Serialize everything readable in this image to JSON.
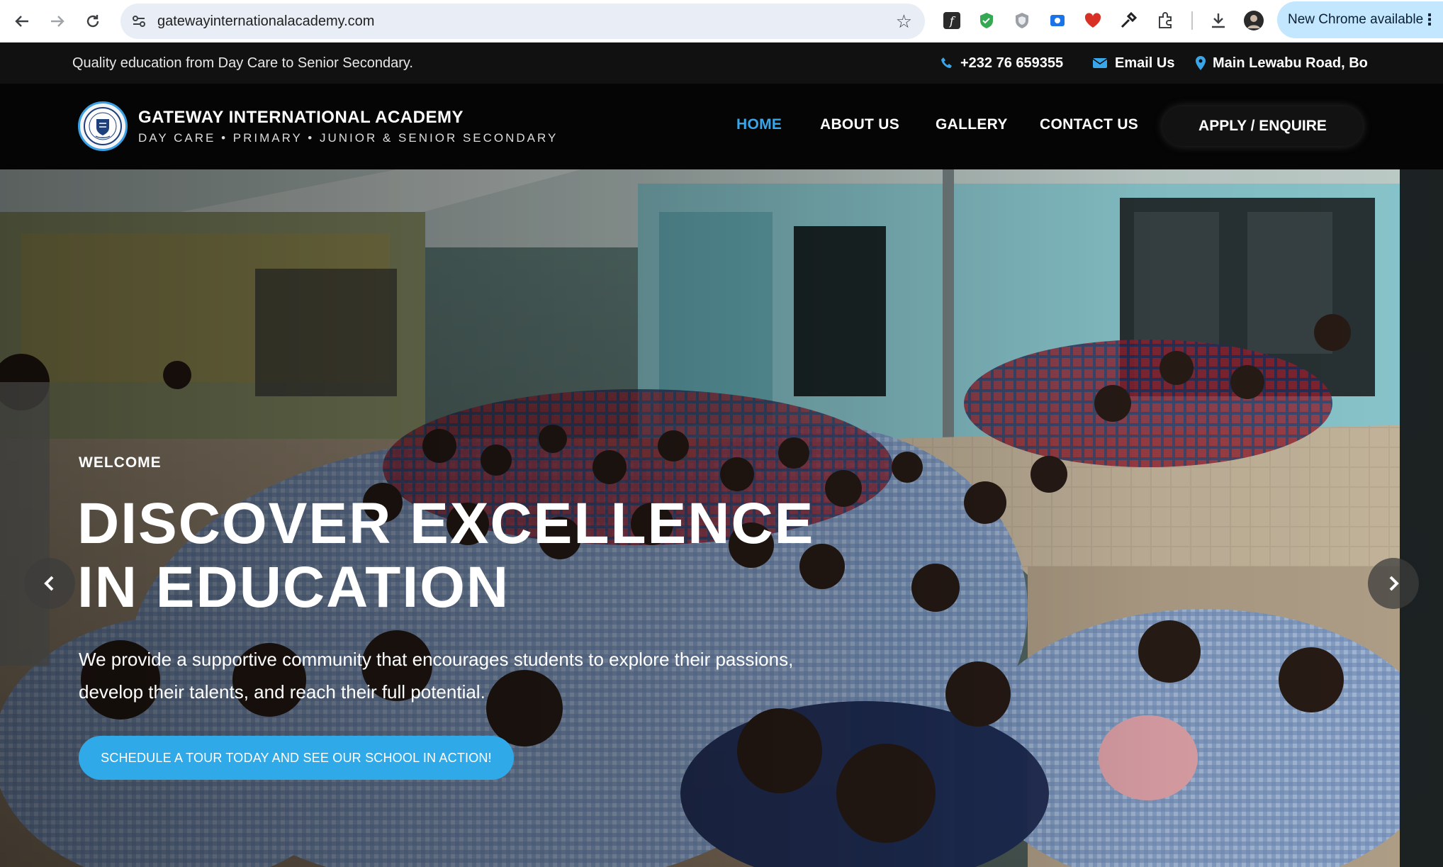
{
  "browser": {
    "url": "gatewayinternationalacademy.com",
    "update_label": "New Chrome available"
  },
  "topbar": {
    "tagline": "Quality education from Day Care to Senior Secondary.",
    "phone": "+232 76 659355",
    "email": "Email Us",
    "address": "Main Lewabu Road, Bo"
  },
  "header": {
    "brand_name": "GATEWAY INTERNATIONAL ACADEMY",
    "brand_sub": "DAY CARE • PRIMARY • JUNIOR & SENIOR SECONDARY",
    "nav": [
      "HOME",
      "ABOUT US",
      "GALLERY",
      "CONTACT US"
    ],
    "apply_label": "APPLY / ENQUIRE"
  },
  "hero": {
    "eyebrow": "WELCOME",
    "headline_line1": "DISCOVER EXCELLENCE",
    "headline_line2": "IN EDUCATION",
    "text": "We provide a supportive community that encourages students to explore their passions, develop their talents, and reach their full potential.",
    "cta_label": "SCHEDULE A TOUR TODAY AND SEE OUR SCHOOL IN ACTION!"
  },
  "colors": {
    "accent": "#3aa6ea",
    "cta": "#2fa9e8",
    "topbar_bg": "#111111",
    "header_bg": "#050505",
    "chrome_pill": "#c2e7ff"
  },
  "icons": {
    "topbar": [
      "phone-icon",
      "mail-icon",
      "map-pin-icon"
    ],
    "browser": [
      "back-icon",
      "forward-icon",
      "reload-icon",
      "site-info-icon",
      "bookmark-star-icon",
      "download-icon",
      "profile-avatar-icon"
    ],
    "hero": [
      "chevron-left-icon",
      "chevron-right-icon"
    ]
  }
}
